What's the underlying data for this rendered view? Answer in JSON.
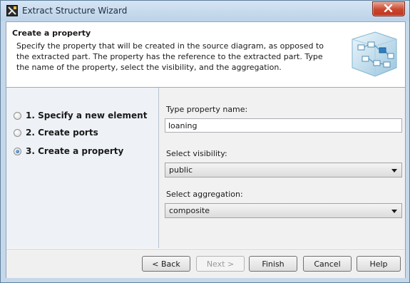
{
  "window": {
    "title": "Extract Structure Wizard"
  },
  "header": {
    "title": "Create a property",
    "description": "Specify the property that will be created in the source diagram, as opposed to the extracted part. The property has the reference to the extracted part. Type the name of the property, select the visibility, and the aggregation."
  },
  "steps": [
    {
      "label": "1. Specify a new element",
      "selected": false
    },
    {
      "label": "2. Create ports",
      "selected": false
    },
    {
      "label": "3. Create a property",
      "selected": true
    }
  ],
  "form": {
    "property_name_label": "Type property name:",
    "property_name_value": "loaning",
    "visibility_label": "Select visibility:",
    "visibility_value": "public",
    "aggregation_label": "Select aggregation:",
    "aggregation_value": "composite"
  },
  "buttons": {
    "back": "< Back",
    "next": "Next >",
    "finish": "Finish",
    "cancel": "Cancel",
    "help": "Help"
  },
  "icons": {
    "app": "wizard-app-icon",
    "close": "close-icon",
    "header_art": "structure-diagram-art",
    "dropdown": "chevron-down-icon"
  }
}
